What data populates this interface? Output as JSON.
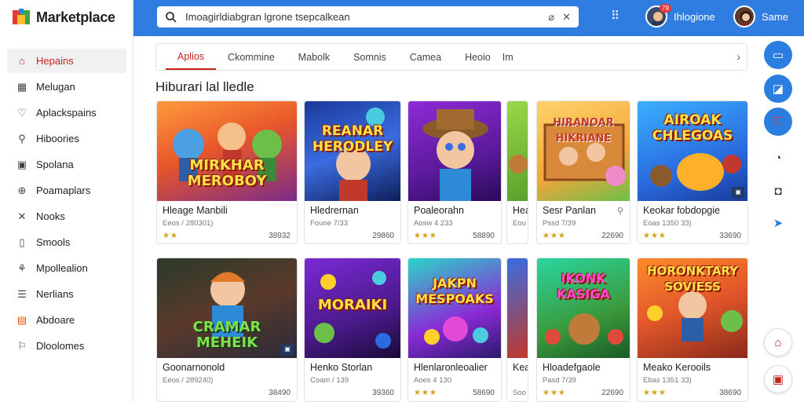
{
  "app": {
    "title": "Marketplace"
  },
  "sidebar": {
    "items": [
      {
        "label": "Hepains",
        "icon": "home-icon",
        "active": true
      },
      {
        "label": "Melugan",
        "icon": "grid-icon"
      },
      {
        "label": "Aplackspains",
        "icon": "heart-icon"
      },
      {
        "label": "Hiboories",
        "icon": "link-icon"
      },
      {
        "label": "Spolana",
        "icon": "page-icon"
      },
      {
        "label": "Poamaplars",
        "icon": "gift-icon"
      },
      {
        "label": "Nooks",
        "icon": "x-icon"
      },
      {
        "label": "Smools",
        "icon": "doc-icon"
      },
      {
        "label": "Mpollealion",
        "icon": "leaf-icon"
      },
      {
        "label": "Nerlians",
        "icon": "list-icon"
      },
      {
        "label": "Abdoare",
        "icon": "store-icon"
      },
      {
        "label": "Dloolomes",
        "icon": "pin-icon"
      }
    ]
  },
  "search": {
    "value": "Imoagirldiabgran lgrone tsepcalkean"
  },
  "topbar": {
    "notify_count": "79",
    "user1_name": "Ihlogione",
    "user2_name": "Same"
  },
  "tabs": [
    {
      "label": "Aplios",
      "active": true
    },
    {
      "label": "Ckommine"
    },
    {
      "label": "Mabolk"
    },
    {
      "label": "Somnis"
    },
    {
      "label": "Camea"
    },
    {
      "label": "Heoio"
    },
    {
      "label": "Im"
    }
  ],
  "section": {
    "title": "Hiburari lal lledle"
  },
  "row1": [
    {
      "art": "MIRKHAR MEROBOY",
      "name": "Hleage Manbili",
      "meta": "Eeos / 280301)",
      "stars": "★★",
      "price": "38932"
    },
    {
      "art": "REANAR HERODLEY",
      "name": "Hledrernan",
      "meta": "Foune 7/33",
      "stars": "",
      "price": "29860"
    },
    {
      "art": "",
      "name": "Poaleorahn",
      "meta": "Aosw 4 233",
      "stars": "★★★",
      "price": "58890"
    },
    {
      "art": "",
      "name": "Hea",
      "meta": "Eou",
      "stars": "",
      "price": ""
    },
    {
      "art": "HIRANOAR HIKRIANE",
      "name": "Sesr Panlan",
      "meta": "Pssd 7/39",
      "stars": "★★★",
      "price": "22690"
    },
    {
      "art": "AIROAK CHLEGOAS",
      "name": "Keokar fobdopgie",
      "meta": "Eoas 1350 33)",
      "stars": "★★★",
      "price": "33690"
    }
  ],
  "row2": [
    {
      "art": "CRAMAR MEHEIK",
      "name": "Goonarnonold",
      "meta": "Eeos / 289240)",
      "stars": "",
      "price": "38490"
    },
    {
      "art": "MORAIKI",
      "name": "Henko Storlan",
      "meta": "Coam / 139",
      "stars": "",
      "price": "39360"
    },
    {
      "art": "JAKPN MESPOAKS",
      "name": "Hlenlaronleoalier",
      "meta": "Aoes 4 130",
      "stars": "★★★",
      "price": "58690"
    },
    {
      "art": "",
      "name": "Kea",
      "meta": "Soo",
      "stars": "",
      "price": ""
    },
    {
      "art": "IKONK KASIGA",
      "name": "Hloadefgaole",
      "meta": "Pasd 7/39",
      "stars": "★★★",
      "price": "22690"
    },
    {
      "art": "HORONKTARY SOVIESS",
      "name": "Meako Kerooils",
      "meta": "Ebas 1351 33)",
      "stars": "★★★",
      "price": "38690"
    }
  ],
  "colors": {
    "accent": "#2f7de1",
    "active": "#c5221f"
  }
}
